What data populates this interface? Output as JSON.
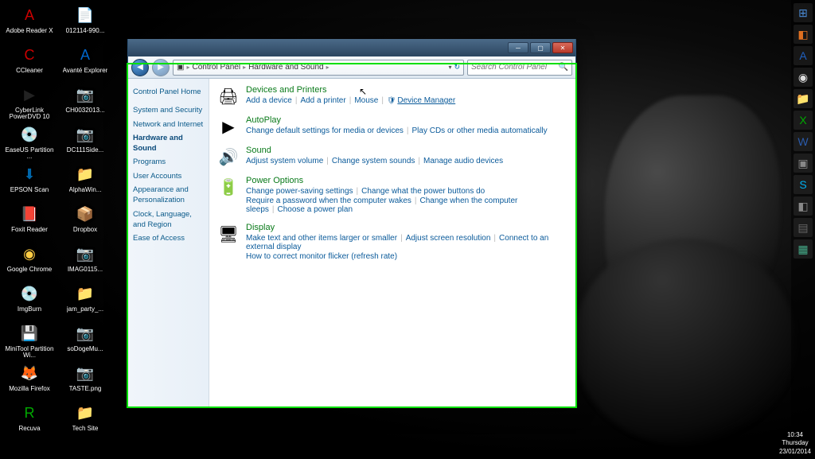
{
  "desktop": {
    "icons": [
      {
        "label": "Adobe Reader X",
        "color": "#c00",
        "glyph": "A"
      },
      {
        "label": "012114-990...",
        "color": "#fff",
        "glyph": "📄"
      },
      {
        "label": "CCleaner",
        "color": "#c00",
        "glyph": "C"
      },
      {
        "label": "Avanté Explorer",
        "color": "#06c",
        "glyph": "A"
      },
      {
        "label": "CyberLink PowerDVD 10",
        "color": "#222",
        "glyph": "▶"
      },
      {
        "label": "CH0032013...",
        "color": "#333",
        "glyph": "📷"
      },
      {
        "label": "EaseUS Partition ...",
        "color": "#fff",
        "glyph": "💿"
      },
      {
        "label": "DC111Side...",
        "color": "#333",
        "glyph": "📷"
      },
      {
        "label": "EPSON Scan",
        "color": "#06a",
        "glyph": "⬇"
      },
      {
        "label": "AlphaWin...",
        "color": "#888",
        "glyph": "📁"
      },
      {
        "label": "Foxit Reader",
        "color": "#e60",
        "glyph": "📕"
      },
      {
        "label": "Dropbox",
        "color": "#07c",
        "glyph": "📦"
      },
      {
        "label": "Google Chrome",
        "color": "#fc4",
        "glyph": "◉"
      },
      {
        "label": "IMAG0115...",
        "color": "#333",
        "glyph": "📷"
      },
      {
        "label": "ImgBurn",
        "color": "#aaa",
        "glyph": "💿"
      },
      {
        "label": "jam_party_...",
        "color": "#e82",
        "glyph": "📁"
      },
      {
        "label": "MiniTool Partition Wi...",
        "color": "#0ac",
        "glyph": "💾"
      },
      {
        "label": "soDogeMu...",
        "color": "#333",
        "glyph": "📷"
      },
      {
        "label": "Mozilla Firefox",
        "color": "#e60",
        "glyph": "🦊"
      },
      {
        "label": "TASTE.png",
        "color": "#333",
        "glyph": "📷"
      },
      {
        "label": "Recuva",
        "color": "#0a0",
        "glyph": "R"
      },
      {
        "label": "Tech Site",
        "color": "#ca8",
        "glyph": "📁"
      }
    ]
  },
  "taskbar": {
    "items": [
      {
        "color": "#4a8ad4",
        "glyph": "⊞",
        "name": "start-button"
      },
      {
        "color": "#e07020",
        "glyph": "◧",
        "name": "outlook-icon"
      },
      {
        "color": "#2060c0",
        "glyph": "A",
        "name": "app-icon"
      },
      {
        "color": "#ddd",
        "glyph": "◉",
        "name": "chrome-icon"
      },
      {
        "color": "#f0c040",
        "glyph": "📁",
        "name": "explorer-icon"
      },
      {
        "color": "#0a0",
        "glyph": "X",
        "name": "excel-icon"
      },
      {
        "color": "#2a5aaa",
        "glyph": "W",
        "name": "word-icon"
      },
      {
        "color": "#888",
        "glyph": "▣",
        "name": "app-icon-2"
      },
      {
        "color": "#00aff0",
        "glyph": "S",
        "name": "skype-icon"
      },
      {
        "color": "#888",
        "glyph": "◧",
        "name": "app-icon-3"
      },
      {
        "color": "#666",
        "glyph": "▤",
        "name": "app-icon-4"
      },
      {
        "color": "#4a8",
        "glyph": "▦",
        "name": "app-icon-5"
      }
    ]
  },
  "clock": {
    "time": "10:34",
    "day": "Thursday",
    "date": "23/01/2014"
  },
  "window": {
    "nav": {
      "root": "Control Panel",
      "current": "Hardware and Sound",
      "search_placeholder": "Search Control Panel"
    },
    "sidebar": {
      "home": "Control Panel Home",
      "items": [
        "System and Security",
        "Network and Internet",
        "Hardware and Sound",
        "Programs",
        "User Accounts",
        "Appearance and Personalization",
        "Clock, Language, and Region",
        "Ease of Access"
      ],
      "active_index": 2
    },
    "categories": [
      {
        "title": "Devices and Printers",
        "icon": "🖨",
        "lines": [
          [
            "Add a device",
            "Add a printer",
            "Mouse",
            "🛡Device Manager"
          ]
        ],
        "highlight": "Device Manager"
      },
      {
        "title": "AutoPlay",
        "icon": "▶",
        "lines": [
          [
            "Change default settings for media or devices",
            "Play CDs or other media automatically"
          ]
        ]
      },
      {
        "title": "Sound",
        "icon": "🔊",
        "lines": [
          [
            "Adjust system volume",
            "Change system sounds",
            "Manage audio devices"
          ]
        ]
      },
      {
        "title": "Power Options",
        "icon": "🔋",
        "lines": [
          [
            "Change power-saving settings",
            "Change what the power buttons do"
          ],
          [
            "Require a password when the computer wakes",
            "Change when the computer sleeps",
            "Choose a power plan"
          ]
        ]
      },
      {
        "title": "Display",
        "icon": "🖥",
        "lines": [
          [
            "Make text and other items larger or smaller",
            "Adjust screen resolution",
            "Connect to an external display"
          ],
          [
            "How to correct monitor flicker (refresh rate)"
          ]
        ]
      }
    ]
  }
}
